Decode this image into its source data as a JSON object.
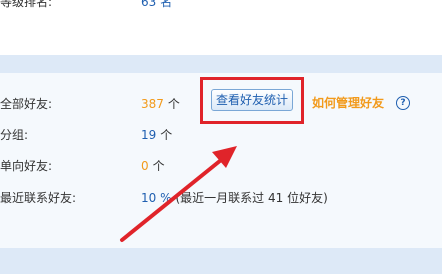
{
  "top_row": {
    "label": "等级排名:",
    "value": "63 名"
  },
  "stats": {
    "all_friends": {
      "label": "全部好友:",
      "value": "387",
      "unit": "个"
    },
    "groups": {
      "label": "分组:",
      "value": "19",
      "unit": "个"
    },
    "one_way": {
      "label": "单向好友:",
      "value": "0",
      "unit": "个"
    },
    "recent": {
      "label": "最近联系好友:",
      "value": "10 %",
      "note": "(最近一月联系过 41 位好友)"
    }
  },
  "buttons": {
    "view_stats": "查看好友统计"
  },
  "links": {
    "manage_friends": "如何管理好友"
  },
  "icons": {
    "help": "help-icon",
    "arrow": "annotation-arrow"
  },
  "colors": {
    "annotation": "#e0242a",
    "accent_orange": "#f29a1b",
    "link_blue": "#1f5fb0",
    "band": "#dde9f7"
  }
}
